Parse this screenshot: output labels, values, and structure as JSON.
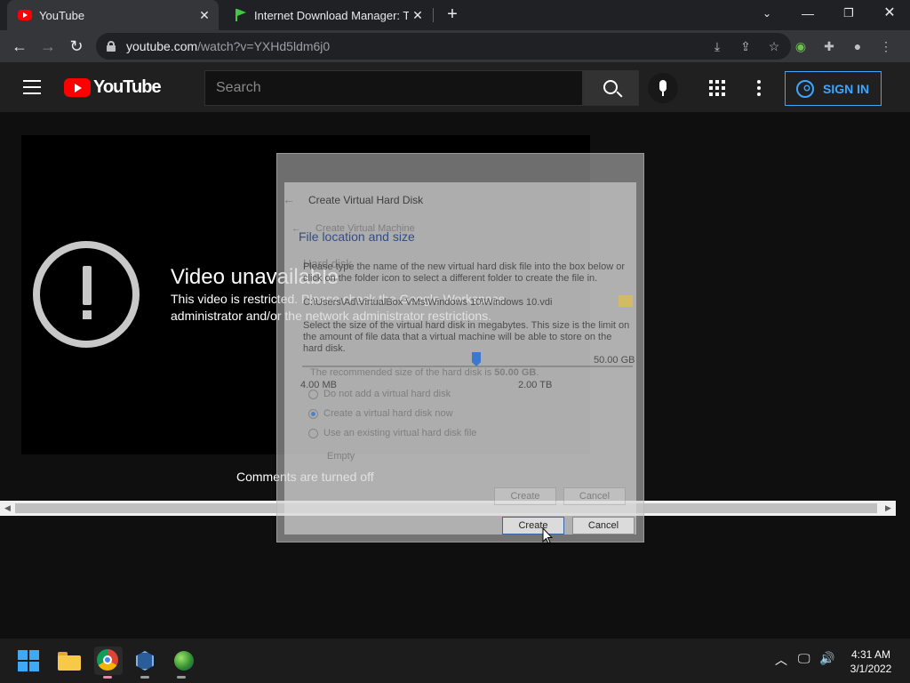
{
  "browser": {
    "tabs": [
      {
        "title": "YouTube",
        "active": true,
        "favicon": "youtube-icon"
      },
      {
        "title": "Internet Download Manager: The",
        "active": false,
        "favicon": "idm-flag-icon"
      }
    ],
    "url_host": "youtube.com",
    "url_path": "/watch?v=YXHd5ldm6j0"
  },
  "youtube": {
    "logo_text": "YouTube",
    "search_placeholder": "Search",
    "signin_label": "SIGN IN",
    "accent_color": "#3ea6ff"
  },
  "player": {
    "title": "Video unavailable",
    "message": "This video is restricted. Please check the Google Workspace administrator and/or the network administrator restrictions."
  },
  "comments": {
    "status": "Comments are turned off"
  },
  "ghost_dialog": {
    "title": "Create Virtual Hard Disk",
    "back_title": "Create Virtual Machine",
    "section_heading": "File location and size",
    "section_heading_back": "Hard disk",
    "instructions": "Please type the name of the new virtual hard disk file into the box below or click on the folder icon to select a different folder to create the file in.",
    "file_path": "C:\\Users\\Ad\\VirtualBox VMs\\Windows 10\\Windows 10.vdi",
    "size_instructions": "Select the size of the virtual hard disk in megabytes. This size is the limit on the amount of file data that a virtual machine will be able to store on the hard disk.",
    "size_value": "50.00 GB",
    "min_size": "4.00 MB",
    "max_size": "2.00 TB",
    "recommended_prefix": "The recommended size of the hard disk is",
    "recommended_size": "50.00 GB",
    "options": [
      "Do not add a virtual hard disk",
      "Create a virtual hard disk now",
      "Use an existing virtual hard disk file"
    ],
    "selected_option_index": 1,
    "existing_file_value": "Empty",
    "create_label": "Create",
    "cancel_label": "Cancel"
  },
  "taskbar": {
    "time": "4:31 AM",
    "date": "3/1/2022"
  }
}
